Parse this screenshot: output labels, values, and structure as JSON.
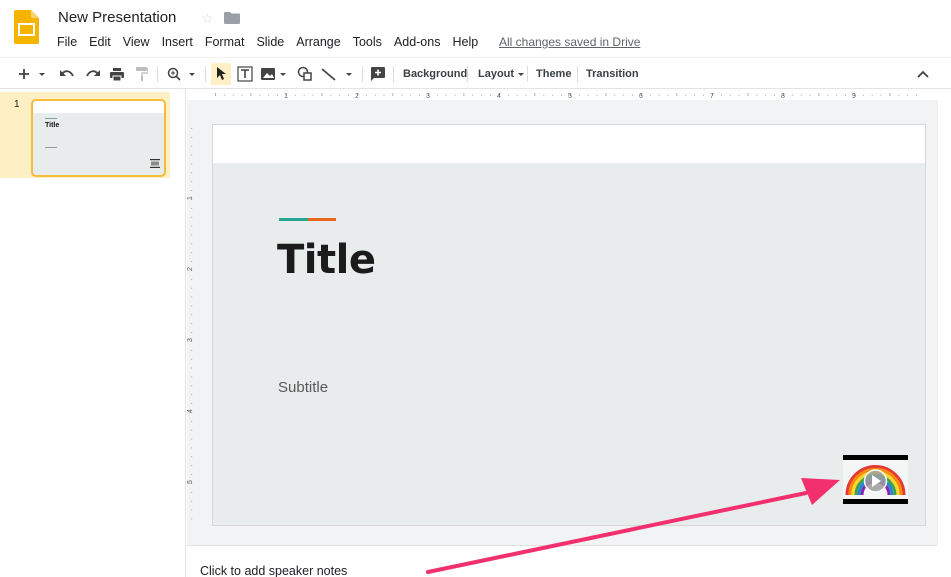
{
  "header": {
    "doc_title": "New Presentation",
    "save_status": "All changes saved in Drive"
  },
  "menubar": {
    "items": [
      "File",
      "Edit",
      "View",
      "Insert",
      "Format",
      "Slide",
      "Arrange",
      "Tools",
      "Add-ons",
      "Help"
    ]
  },
  "toolbar": {
    "background_label": "Background",
    "layout_label": "Layout",
    "theme_label": "Theme",
    "transition_label": "Transition"
  },
  "filmstrip": {
    "slides": [
      {
        "number": "1",
        "title": "Title"
      }
    ]
  },
  "ruler": {
    "h_labels": [
      "1",
      "2",
      "3",
      "4",
      "5",
      "6",
      "7",
      "8",
      "9"
    ],
    "v_labels": [
      "1",
      "2",
      "3",
      "4",
      "5"
    ]
  },
  "slide": {
    "title": "Title",
    "subtitle": "Subtitle"
  },
  "notes": {
    "placeholder": "Click to add speaker notes"
  },
  "colors": {
    "accent_teal": "#26a595",
    "accent_orange": "#e8651e",
    "selection_yellow": "#f9bb3c",
    "arrow_pink": "#f2306e"
  }
}
